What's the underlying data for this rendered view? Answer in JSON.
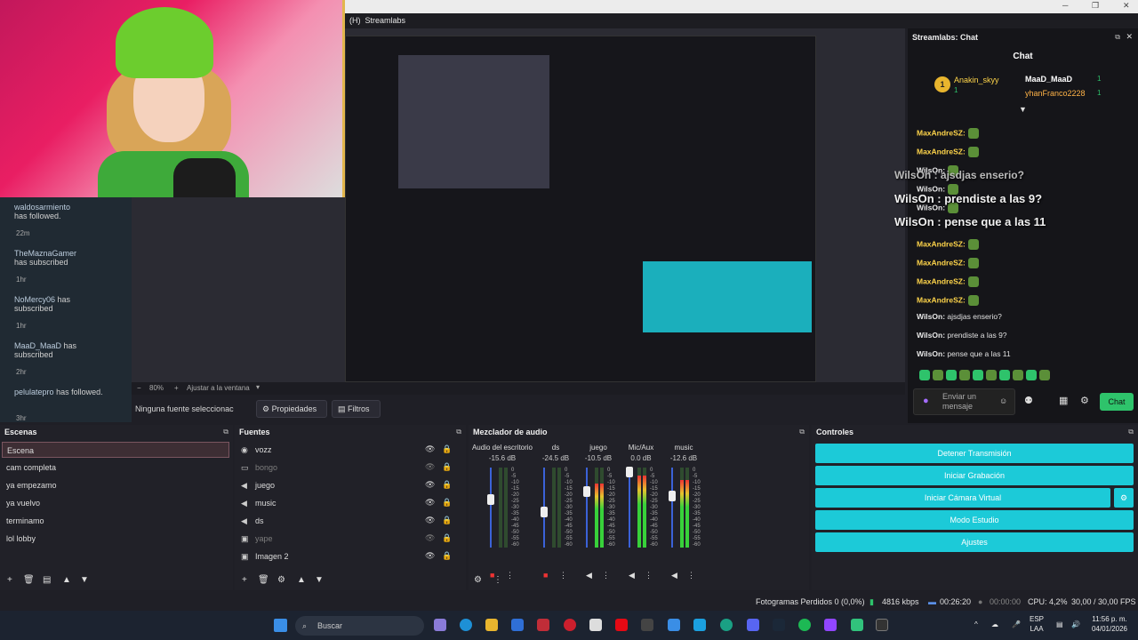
{
  "window": {
    "title": "Streamlabs",
    "title_prefix": "(H)"
  },
  "stream_events": [
    {
      "user": "waldosarmiento",
      "action": "has followed.",
      "time": "22m"
    },
    {
      "user": "TheMaznaGamer",
      "action": "has subscribed",
      "time": "1hr"
    },
    {
      "user": "NoMercy06",
      "action": "has subscribed",
      "time": "1hr"
    },
    {
      "user": "MaaD_MaaD",
      "action": "has subscribed",
      "time": "2hr"
    },
    {
      "user": "pelulatepro",
      "action": "has followed.",
      "time": "3hr"
    }
  ],
  "preview": {
    "zoom": "80%",
    "zoom_option": "Ajustar a la ventana",
    "no_source_label": "Ninguna fuente seleccionac",
    "properties_label": "Propiedades",
    "filters_label": "Filtros"
  },
  "chat": {
    "dock_title": "Streamlabs: Chat",
    "header": "Chat",
    "top_users": [
      {
        "rank": "1",
        "name": "Anakin_skyy",
        "count": "1"
      },
      {
        "name": "MaaD_MaaD",
        "count": "1"
      },
      {
        "name": "yhanFranco2228",
        "count": "1"
      }
    ],
    "overlay_messages": [
      {
        "user": "WilsOn",
        "text": "ajsdjas enserio?"
      },
      {
        "user": "WilsOn",
        "text": "prendiste a las 9?"
      },
      {
        "user": "WilsOn",
        "text": "pense que a las 11"
      }
    ],
    "messages": [
      {
        "user": "MaxAndreSZ:",
        "text": ""
      },
      {
        "user": "MaxAndreSZ:",
        "text": ""
      },
      {
        "user": "WilsOn:",
        "text": ""
      },
      {
        "user": "WilsOn:",
        "text": ""
      },
      {
        "user": "WilsOn:",
        "text": ""
      },
      {
        "user": "MaxAndreSZ:",
        "text": ""
      },
      {
        "user": "MaxAndreSZ:",
        "text": ""
      },
      {
        "user": "MaxAndreSZ:",
        "text": ""
      },
      {
        "user": "MaxAndreSZ:",
        "text": ""
      },
      {
        "user": "WilsOn:",
        "text": "ajsdjas enserio?"
      },
      {
        "user": "WilsOn:",
        "text": "prendiste a las 9?"
      },
      {
        "user": "WilsOn:",
        "text": "pense que a las 11"
      }
    ],
    "input_placeholder": "Enviar un mensaje",
    "send_label": "Chat"
  },
  "scenes": {
    "title": "Escenas",
    "items": [
      "Escena",
      "cam completa",
      "ya empezamo",
      "ya vuelvo",
      "terminamo",
      "lol lobby"
    ],
    "selected": "Escena"
  },
  "sources": {
    "title": "Fuentes",
    "items": [
      {
        "name": "vozz",
        "icon": "audio-icon",
        "visible": true
      },
      {
        "name": "bongo",
        "icon": "window-icon",
        "visible": false
      },
      {
        "name": "juego",
        "icon": "speaker-icon",
        "visible": true
      },
      {
        "name": "music",
        "icon": "speaker-icon",
        "visible": true
      },
      {
        "name": "ds",
        "icon": "speaker-icon",
        "visible": true
      },
      {
        "name": "yape",
        "icon": "image-icon",
        "visible": false
      },
      {
        "name": "Imagen 2",
        "icon": "image-icon",
        "visible": true
      }
    ]
  },
  "mixer": {
    "title": "Mezclador de audio",
    "channels": [
      {
        "name": "Audio del escritorio",
        "db": "-15.6 dB",
        "level": 0.0,
        "muted": true,
        "fader": 0.6
      },
      {
        "name": "ds",
        "db": "-24.5 dB",
        "level": 0.0,
        "muted": true,
        "fader": 0.45
      },
      {
        "name": "juego",
        "db": "-10.5 dB",
        "level": 0.8,
        "muted": false,
        "fader": 0.7
      },
      {
        "name": "Mic/Aux",
        "db": "0.0 dB",
        "level": 0.9,
        "muted": false,
        "fader": 0.95
      },
      {
        "name": "music",
        "db": "-12.6 dB",
        "level": 0.85,
        "muted": false,
        "fader": 0.65
      }
    ],
    "scale": [
      "0",
      "-5",
      "-10",
      "-15",
      "-20",
      "-25",
      "-30",
      "-35",
      "-40",
      "-45",
      "-50",
      "-55",
      "-60"
    ]
  },
  "controls": {
    "title": "Controles",
    "buttons": [
      "Detener Transmisión",
      "Iniciar Grabación",
      "Iniciar Cámara Virtual",
      "Modo Estudio",
      "Ajustes"
    ]
  },
  "status": {
    "dropped_frames": "Fotogramas Perdidos 0 (0,0%)",
    "bitrate": "4816 kbps",
    "stream_time": "00:26:20",
    "rec_time": "00:00:00",
    "cpu": "CPU: 4,2%",
    "fps": "30,00 / 30,00 FPS"
  },
  "taskbar": {
    "search_placeholder": "Buscar",
    "lang_top": "ESP",
    "lang_bottom": "LAA",
    "time": "11:56 p. m.",
    "date": "04/01/2026"
  },
  "colors": {
    "accent": "#1ccad8",
    "bg": "#1f1f26",
    "chat_name": "#ffd54a"
  }
}
